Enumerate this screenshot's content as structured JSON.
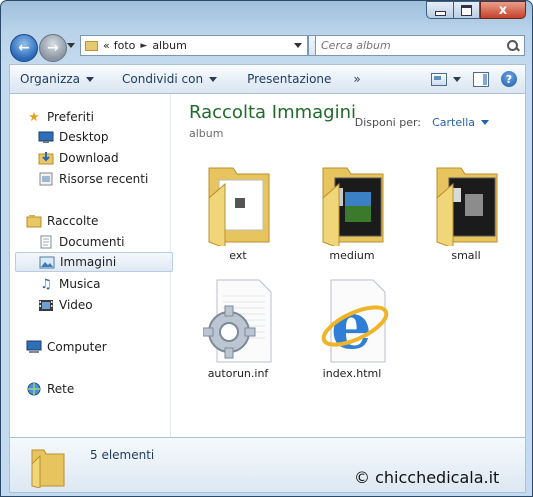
{
  "window": {
    "close_glyph": "x"
  },
  "navigation": {
    "breadcrumb_prefix": "«",
    "breadcrumb": [
      "foto",
      "album"
    ],
    "search_placeholder": "Cerca album"
  },
  "toolbar": {
    "organize_label": "Organizza",
    "share_label": "Condividi con",
    "slideshow_label": "Presentazione",
    "more_label": "»",
    "views_icon": "views-icon",
    "preview_icon": "preview-pane-icon",
    "help_icon": "help-icon",
    "help_glyph": "?"
  },
  "sidebar": {
    "favorites_label": "Preferiti",
    "favorites": [
      {
        "label": "Desktop",
        "icon": "desktop-icon"
      },
      {
        "label": "Download",
        "icon": "download-icon"
      },
      {
        "label": "Risorse recenti",
        "icon": "recent-icon"
      }
    ],
    "libraries_label": "Raccolte",
    "libraries": [
      {
        "label": "Documenti",
        "icon": "documents-icon"
      },
      {
        "label": "Immagini",
        "icon": "pictures-icon",
        "selected": true
      },
      {
        "label": "Musica",
        "icon": "music-icon"
      },
      {
        "label": "Video",
        "icon": "video-icon"
      }
    ],
    "computer_label": "Computer",
    "network_label": "Rete"
  },
  "main": {
    "library_title": "Raccolta Immagini",
    "library_subtitle": "album",
    "arrange_label": "Disponi per:",
    "arrange_value": "Cartella",
    "files": [
      {
        "name": "ext",
        "type": "folder"
      },
      {
        "name": "medium",
        "type": "folder"
      },
      {
        "name": "small",
        "type": "folder"
      },
      {
        "name": "autorun.inf",
        "type": "settings-file"
      },
      {
        "name": "index.html",
        "type": "html-file"
      }
    ]
  },
  "status": {
    "count_text": "5 elementi"
  },
  "watermark": "© chicchedicala.it",
  "colors": {
    "library_title": "#1f6b2a",
    "link_blue": "#2563a8",
    "frame_blue": "#c4daee"
  }
}
